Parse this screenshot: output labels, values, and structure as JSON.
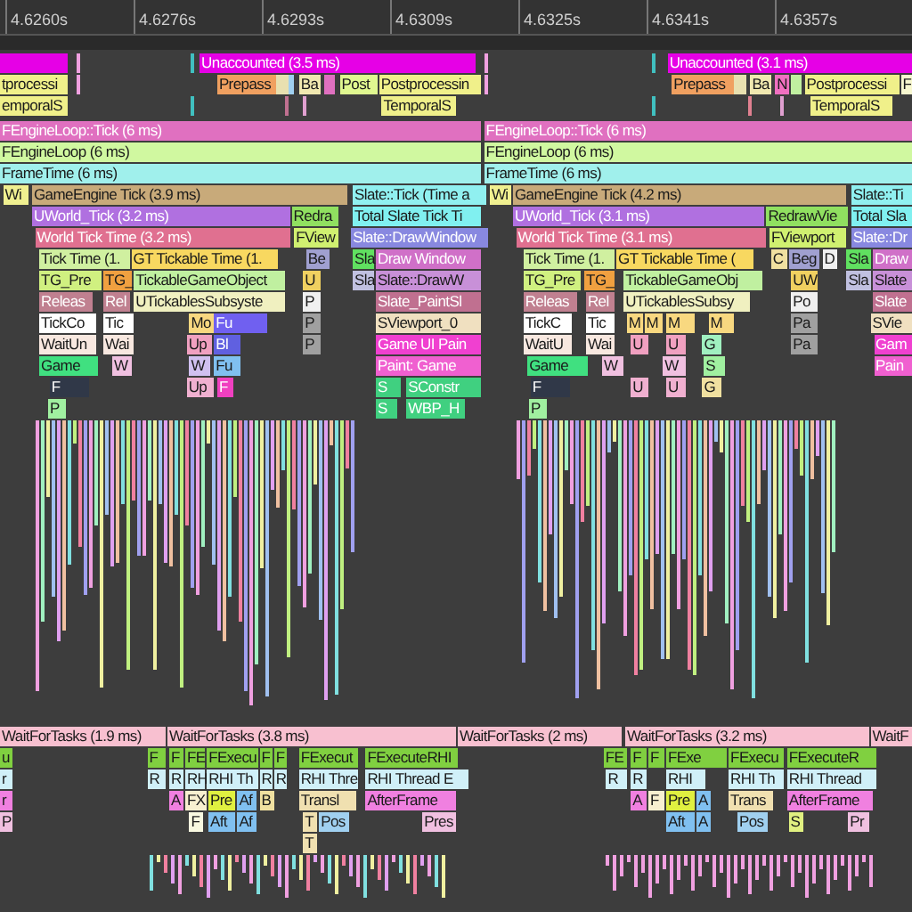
{
  "ruler": {
    "ticks": [
      {
        "label": "4.6260s"
      },
      {
        "label": "4.6276s"
      },
      {
        "label": "4.6293s"
      },
      {
        "label": "4.6309s"
      },
      {
        "label": "4.6325s"
      },
      {
        "label": "4.6341s"
      },
      {
        "label": "4.6357s"
      }
    ]
  },
  "gpu_tracks": [
    [
      {
        "color": "#e600e6"
      },
      {
        "color": "#f0a0e0"
      },
      {
        "color": "#40c0c0"
      },
      {
        "label": "Unaccounted (3.5 ms)",
        "color": "#e600e6"
      },
      {
        "color": "#f0a0e0"
      },
      {
        "color": "#40c0c0"
      },
      {
        "label": "Unaccounted (3.1 ms)",
        "color": "#e600e6"
      }
    ],
    [
      {
        "label": "tprocessi",
        "color": "#f0f08a"
      },
      {
        "color": "#f0a0e0"
      },
      {
        "label": "Prepass",
        "color": "#f0a060"
      },
      {
        "color": "#e8e0b0"
      },
      {
        "color": "#a0d0f0"
      },
      {
        "label": "Ba",
        "color": "#f0e8b0"
      },
      {
        "color": "#e070c0"
      },
      {
        "label": "Post",
        "color": "#e0f890"
      },
      {
        "label": "Postprocessin",
        "color": "#f0f08a"
      },
      {
        "color": "#f0a0e0"
      },
      {
        "label": "Prepass",
        "color": "#f0a060"
      },
      {
        "color": "#e8e0b0"
      },
      {
        "label": "Ba",
        "color": "#f0e8b0"
      },
      {
        "label": "N",
        "color": "#f070c0"
      },
      {
        "color": "#c0f0a0"
      },
      {
        "label": "Postprocessi",
        "color": "#f0f08a"
      },
      {
        "label": "F",
        "color": "#f8f8d0"
      }
    ],
    [
      {
        "label": "emporalS",
        "color": "#f0f08a"
      },
      {
        "color": "#40c0c0"
      },
      {
        "color": "#c07090"
      },
      {
        "color": "#e0a0d0"
      },
      {
        "label": "TemporalS",
        "color": "#f0f08a"
      },
      {
        "color": "#40c0c0"
      },
      {
        "color": "#e08090"
      },
      {
        "color": "#e0a0d0"
      },
      {
        "label": "TemporalS",
        "color": "#f0f08a"
      }
    ]
  ],
  "cpu_tracks": [
    [
      {
        "label": "FEngineLoop::Tick (6 ms)",
        "color": "#e070c0"
      },
      {
        "label": "FEngineLoop::Tick (6 ms)",
        "color": "#e070c0"
      }
    ],
    [
      {
        "label": "FEngineLoop (6 ms)",
        "color": "#d0f8a0"
      },
      {
        "label": "FEngineLoop (6 ms)",
        "color": "#d0f8a0"
      }
    ],
    [
      {
        "label": "FrameTime (6 ms)",
        "color": "#a0f0ec"
      },
      {
        "label": "FrameTime (6 ms)",
        "color": "#a0f0ec"
      }
    ],
    [
      {
        "label": "Wi",
        "color": "#f0f090"
      },
      {
        "label": "GameEngine Tick (3.9 ms)",
        "color": "#c8aa7a"
      },
      {
        "label": "Slate::Tick (Time a",
        "color": "#90f0f0"
      },
      {
        "label": "Wi",
        "color": "#f0f090"
      },
      {
        "label": "GameEngine Tick (4.2 ms)",
        "color": "#c8aa7a"
      },
      {
        "label": "Slate::Ti",
        "color": "#90f0f0"
      }
    ],
    [
      {
        "label": "UWorld_Tick (3.2 ms)",
        "color": "#b070e0"
      },
      {
        "label": "Redra",
        "color": "#90e060"
      },
      {
        "label": "Total Slate Tick Ti",
        "color": "#80f0f0"
      },
      {
        "label": "UWorld_Tick (3.1 ms)",
        "color": "#b070e0"
      },
      {
        "label": "RedrawVie",
        "color": "#90e060"
      },
      {
        "label": "Total Sla",
        "color": "#80f0f0"
      }
    ],
    [
      {
        "label": "World Tick Time (3.2 ms)",
        "color": "#e07090"
      },
      {
        "label": "FView",
        "color": "#d0f070"
      },
      {
        "label": "Slate::DrawWindow",
        "color": "#8888e0"
      },
      {
        "label": "World Tick Time (3.1 ms)",
        "color": "#e07090"
      },
      {
        "label": "FViewport",
        "color": "#d0f070"
      },
      {
        "label": "Slate::Dr",
        "color": "#8888e0"
      }
    ],
    [
      {
        "label": "Tick Time (1.",
        "color": "#d0f0a0"
      },
      {
        "label": "GT Tickable Time (1.",
        "color": "#f8d860"
      },
      {
        "label": "Be",
        "color": "#a0a0d0"
      },
      {
        "label": "Sla",
        "color": "#60e060"
      },
      {
        "label": "Draw Window",
        "color": "#d070c8"
      },
      {
        "label": "Tick Time (1.",
        "color": "#d0f0a0"
      },
      {
        "label": "GT Tickable Time (",
        "color": "#f8d860"
      },
      {
        "label": "C",
        "color": "#f0e0a0"
      },
      {
        "label": "Beg",
        "color": "#a0a0d0"
      },
      {
        "label": "D",
        "color": "#f0f0f0"
      },
      {
        "label": "Sla",
        "color": "#60e060"
      },
      {
        "label": "Draw",
        "color": "#d070c8"
      }
    ],
    [
      {
        "label": "TG_Pre",
        "color": "#d0f080"
      },
      {
        "label": "TG_",
        "color": "#f0a040"
      },
      {
        "label": "TickableGameObject",
        "color": "#c0f0a0"
      },
      {
        "label": "U",
        "color": "#f0d060"
      },
      {
        "label": "Sla",
        "color": "#c0c0e0"
      },
      {
        "label": "Slate::DrawW",
        "color": "#c890d8"
      },
      {
        "label": "TG_Pre",
        "color": "#d0f080"
      },
      {
        "label": "TG_",
        "color": "#f0a040"
      },
      {
        "label": "TickableGameObj",
        "color": "#c0f0a0"
      },
      {
        "label": "UW",
        "color": "#f0d060"
      },
      {
        "label": "Sla",
        "color": "#c0c0e0"
      },
      {
        "label": "Slate",
        "color": "#c890d8"
      }
    ],
    [
      {
        "label": "Releas",
        "color": "#c08090"
      },
      {
        "label": "Rel",
        "color": "#c08090"
      },
      {
        "label": "UTickablesSubsyste",
        "color": "#f0f0c0"
      },
      {
        "label": "P",
        "color": "#f0f0f0"
      },
      {
        "label": "Slate_PaintSl",
        "color": "#c07090"
      },
      {
        "label": "Releas",
        "color": "#c08090"
      },
      {
        "label": "Rel",
        "color": "#c08090"
      },
      {
        "label": "UTickablesSubsy",
        "color": "#f0f0c0"
      },
      {
        "label": "Po",
        "color": "#f0f0f0"
      },
      {
        "label": "Slate",
        "color": "#c07090"
      }
    ],
    [
      {
        "label": "TickCo",
        "color": "#ffffff"
      },
      {
        "label": "Tic",
        "color": "#ffffff"
      },
      {
        "label": "Mo",
        "color": "#f8d880"
      },
      {
        "label": "Fu",
        "color": "#7060f0"
      },
      {
        "label": "P",
        "color": "#a0a0a0"
      },
      {
        "label": "SViewport_0",
        "color": "#f0e0c0"
      },
      {
        "label": "TickC",
        "color": "#ffffff"
      },
      {
        "label": "Tic",
        "color": "#ffffff"
      },
      {
        "label": "M",
        "color": "#f8d880"
      },
      {
        "label": "M",
        "color": "#f8d880"
      },
      {
        "label": "M",
        "color": "#f8d880"
      },
      {
        "label": "M",
        "color": "#f8d880"
      },
      {
        "label": "Pa",
        "color": "#a0a0a0"
      },
      {
        "label": "SVie",
        "color": "#f0e0c0"
      }
    ],
    [
      {
        "label": "WaitUn",
        "color": "#f8e8e0"
      },
      {
        "label": "Wai",
        "color": "#f8e8e0"
      },
      {
        "label": "Up",
        "color": "#f0a0c0"
      },
      {
        "label": "Bl",
        "color": "#6060e0"
      },
      {
        "label": "P",
        "color": "#a0a0a0"
      },
      {
        "label": "Game UI Pain",
        "color": "#f040d0"
      },
      {
        "label": "WaitU",
        "color": "#f8e8e0"
      },
      {
        "label": "Wai",
        "color": "#f8e8e0"
      },
      {
        "label": "U",
        "color": "#f0a0c0"
      },
      {
        "label": "U",
        "color": "#f0a0c0"
      },
      {
        "label": "G",
        "color": "#a0f0c0"
      },
      {
        "label": "Pa",
        "color": "#a0a0a0"
      },
      {
        "label": "Gam",
        "color": "#f040d0"
      }
    ],
    [
      {
        "label": "Game",
        "color": "#40e080"
      },
      {
        "label": "W",
        "color": "#f0c0e0"
      },
      {
        "label": "W",
        "color": "#d0c0f0"
      },
      {
        "label": "Fu",
        "color": "#80c0f0"
      },
      {
        "label": "Paint: Game",
        "color": "#f060d0"
      },
      {
        "label": "Game",
        "color": "#40e080"
      },
      {
        "label": "W",
        "color": "#f0c0e0"
      },
      {
        "label": "W",
        "color": "#f0c0e0"
      },
      {
        "label": "S",
        "color": "#a0f0a0"
      },
      {
        "label": "Pain",
        "color": "#f060d0"
      }
    ],
    [
      {
        "label": "F",
        "color": "#303848"
      },
      {
        "label": "Up",
        "color": "#f0b0d0"
      },
      {
        "label": "F",
        "color": "#f040c0"
      },
      {
        "label": "S",
        "color": "#40d080"
      },
      {
        "label": "SConstr",
        "color": "#40d080"
      },
      {
        "label": "F",
        "color": "#303848"
      },
      {
        "label": "U",
        "color": "#f0b0d0"
      },
      {
        "label": "U",
        "color": "#f0b0d0"
      },
      {
        "label": "G",
        "color": "#f0e0a0"
      }
    ],
    [
      {
        "label": "P",
        "color": "#a0f0a0"
      },
      {
        "label": "S",
        "color": "#40d080"
      },
      {
        "label": "WBP_H",
        "color": "#40d080"
      },
      {
        "label": "P",
        "color": "#a0f0a0"
      }
    ]
  ],
  "task_tracks": [
    [
      {
        "label": "WaitForTasks (1.9 ms)",
        "color": "#f8c0d0"
      },
      {
        "label": "WaitForTasks (3.8 ms)",
        "color": "#f8c0d0"
      },
      {
        "label": "WaitForTasks (2 ms)",
        "color": "#f8c0d0"
      },
      {
        "label": "WaitForTasks (3.2 ms)",
        "color": "#f8c0d0"
      },
      {
        "label": "WaitF",
        "color": "#f8c0d0"
      }
    ],
    [
      {
        "label": "u",
        "color": "#80d040"
      },
      {
        "label": "F",
        "color": "#80d040"
      },
      {
        "label": "F",
        "color": "#80d040"
      },
      {
        "label": "FE",
        "color": "#80d040"
      },
      {
        "label": "FExecu",
        "color": "#80d040"
      },
      {
        "label": "F",
        "color": "#80d040"
      },
      {
        "label": "F",
        "color": "#80d040"
      },
      {
        "label": "FExecut",
        "color": "#80d040"
      },
      {
        "label": "FExecuteRHI",
        "color": "#80d040"
      },
      {
        "label": "FE",
        "color": "#80d040"
      },
      {
        "label": "F",
        "color": "#80d040"
      },
      {
        "label": "F",
        "color": "#80d040"
      },
      {
        "label": "FExe",
        "color": "#80d040"
      },
      {
        "label": "FExecu",
        "color": "#80d040"
      },
      {
        "label": "FExecuteR",
        "color": "#80d040"
      }
    ],
    [
      {
        "label": "r",
        "color": "#d0f0f8"
      },
      {
        "label": "R",
        "color": "#d0f0f8"
      },
      {
        "label": "R",
        "color": "#d0f0f8"
      },
      {
        "label": "RH",
        "color": "#d0f0f8"
      },
      {
        "label": "RHI Th",
        "color": "#d0f0f8"
      },
      {
        "label": "R",
        "color": "#d0f0f8"
      },
      {
        "label": "R",
        "color": "#d0f0f8"
      },
      {
        "label": "RHI Thre",
        "color": "#d0f0f8"
      },
      {
        "label": "RHI Thread E",
        "color": "#d0f0f8"
      },
      {
        "label": "R",
        "color": "#d0f0f8"
      },
      {
        "label": "R",
        "color": "#d0f0f8"
      },
      {
        "label": "RHI",
        "color": "#d0f0f8"
      },
      {
        "label": "RHI Th",
        "color": "#d0f0f8"
      },
      {
        "label": "RHI Thread",
        "color": "#d0f0f8"
      }
    ],
    [
      {
        "label": "r",
        "color": "#f080e0"
      },
      {
        "label": "A",
        "color": "#f080e0"
      },
      {
        "label": "FX",
        "color": "#f8f0d0"
      },
      {
        "label": "Pre",
        "color": "#e0f040"
      },
      {
        "label": "Af",
        "color": "#80c0f0"
      },
      {
        "label": "B",
        "color": "#f0e0a0"
      },
      {
        "label": "Transl",
        "color": "#f0e0b0"
      },
      {
        "label": "AfterFrame",
        "color": "#f080e0"
      },
      {
        "label": "A",
        "color": "#f080e0"
      },
      {
        "label": "F",
        "color": "#f8f0d0"
      },
      {
        "label": "Pre",
        "color": "#e0f040"
      },
      {
        "label": "A",
        "color": "#80c0f0"
      },
      {
        "label": "Trans",
        "color": "#f0e0b0"
      },
      {
        "label": "AfterFrame",
        "color": "#f080e0"
      }
    ],
    [
      {
        "label": "P",
        "color": "#f0c0e0"
      },
      {
        "label": "F",
        "color": "#f8f8e0"
      },
      {
        "label": "Aft",
        "color": "#80c0f0"
      },
      {
        "label": "Af",
        "color": "#80c0f0"
      },
      {
        "label": "T",
        "color": "#f0e0b0"
      },
      {
        "label": "Pos",
        "color": "#a0d0f0"
      },
      {
        "label": "Pres",
        "color": "#f0c0e0"
      },
      {
        "label": "Aft",
        "color": "#80c0f0"
      },
      {
        "label": "A",
        "color": "#80c0f0"
      },
      {
        "label": "Pos",
        "color": "#a0d0f0"
      },
      {
        "label": "S",
        "color": "#e0f080"
      },
      {
        "label": "Pr",
        "color": "#f0c0e0"
      }
    ],
    [
      {
        "label": "T",
        "color": "#f0e0b0"
      }
    ]
  ]
}
